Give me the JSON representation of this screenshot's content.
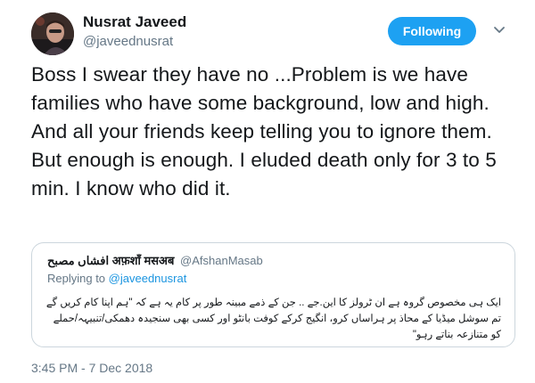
{
  "author": {
    "display_name": "Nusrat Javeed",
    "handle": "@javeednusrat",
    "avatar": "profile-photo"
  },
  "follow_button": {
    "label": "Following",
    "color": "#1da1f2"
  },
  "menu_icon": "chevron-down-icon",
  "tweet": {
    "text": "Boss I swear they have no ...Problem is we have families who have some background, low and high. And all your friends keep telling you to ignore them. But enough is enough. I eluded death only for 3 to 5 min. I know who did it."
  },
  "quoted_tweet": {
    "display_name": "افشاں مصبح अफ़शाँ मसअब",
    "handle": "@AfshanMasab",
    "replying_prefix": "Replying to",
    "replying_to": "@javeednusrat",
    "text": "ایک ہی مخصوص گروہ ہے ان ٹرولز کا این.جے .. جن کے ذمے مبینہ طور پر کام یہ ہے کہ \"ہم اپنا کام کریں گے تم سوشل میڈیا کے محاذ پر ہراساں کرو، انگیج کرکے کوفت بانٹو اور کسی بھی سنجیدہ دھمکی/تنبیہہ/حملے کو متنازعہ بناتے رہو\""
  },
  "timestamp": "3:45 PM - 7 Dec 2018"
}
